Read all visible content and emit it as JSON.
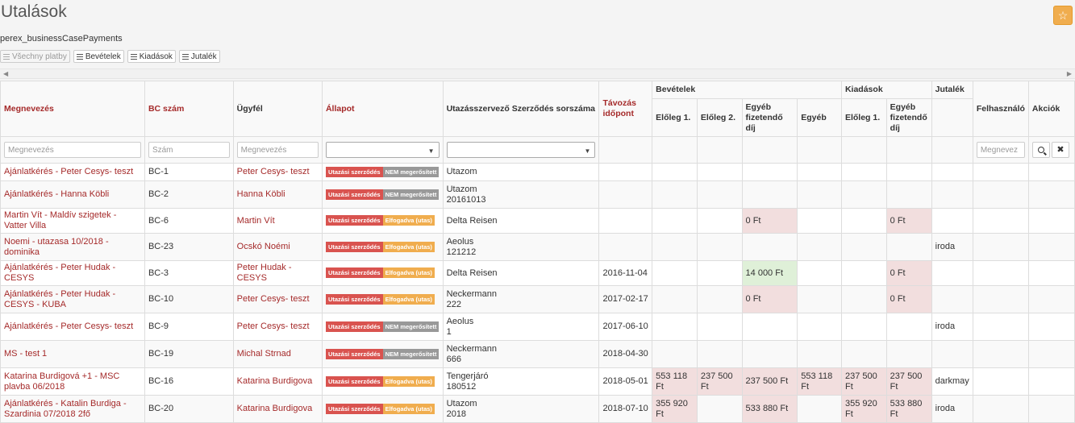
{
  "page": {
    "title": "Utalások",
    "subtitle": "perex_businessCasePayments"
  },
  "filters": [
    "Všechny platby",
    "Bevételek",
    "Kiadások",
    "Jutalék"
  ],
  "header": {
    "group_income": "Bevételek",
    "group_expense": "Kiadások",
    "group_commission": "Jutalék",
    "col_name": "Megnevezés",
    "col_bc": "BC szám",
    "col_client": "Ügyfél",
    "col_state": "Állapot",
    "col_contract": "Utazásszervező Szerződés sorszáma",
    "col_departure": "Távozás időpont",
    "col_user": "Felhasználó",
    "col_actions": "Akciók",
    "inc_adv1": "Előleg 1.",
    "inc_adv2": "Előleg 2.",
    "inc_other_fee": "Egyéb fizetendő díj",
    "inc_other": "Egyéb",
    "exp_adv1": "Előleg 1.",
    "exp_other_fee": "Egyéb fizetendő díj"
  },
  "filter_row": {
    "name_placeholder": "Megnevezés",
    "bc_placeholder": "Szám",
    "client_placeholder": "Megnevezés",
    "user_placeholder": "Megnevez"
  },
  "badges": {
    "contract": "Utazási szerződés",
    "not_confirmed": "NEM megerősített",
    "accepted": "Elfogadva (utas)"
  },
  "colors": {
    "accent": "#a52a2a",
    "star": "#f0ad4e",
    "negative_bg": "#f2dede",
    "positive_bg": "#dff0d8"
  },
  "rows": [
    {
      "name": "Ajánlatkérés - Peter Cesys- teszt",
      "bc": "BC-1",
      "client": "Peter Cesys- teszt",
      "status": "NEM megerősített",
      "contract1": "Utazom",
      "contract2": "",
      "departure": "",
      "inc1": "",
      "inc2": "",
      "incfee": "",
      "incother": "",
      "exp1": "",
      "expfee": "",
      "comm": ""
    },
    {
      "name": "Ajánlatkérés - Hanna Köbli",
      "bc": "BC-2",
      "client": "Hanna Köbli",
      "status": "NEM megerősített",
      "contract1": "Utazom",
      "contract2": "20161013",
      "departure": "",
      "inc1": "",
      "inc2": "",
      "incfee": "",
      "incother": "",
      "exp1": "",
      "expfee": "",
      "comm": ""
    },
    {
      "name": "Martin Vít - Maldív szigetek - Vatter Villa",
      "bc": "BC-6",
      "client": "Martin Vít",
      "status": "Elfogadva (utas)",
      "contract1": "Delta Reisen",
      "contract2": "",
      "departure": "",
      "inc1": "",
      "inc2": "",
      "incfee": "0 Ft",
      "incother": "",
      "exp1": "",
      "expfee": "0 Ft",
      "comm": ""
    },
    {
      "name": "Noemi - utazasa 10/2018 - dominika",
      "bc": "BC-23",
      "client": "Ocskó Noémi",
      "status": "Elfogadva (utas)",
      "contract1": "Aeolus",
      "contract2": "121212",
      "departure": "",
      "inc1": "",
      "inc2": "",
      "incfee": "",
      "incother": "",
      "exp1": "",
      "expfee": "",
      "comm": "iroda"
    },
    {
      "name": "Ajánlatkérés - Peter Hudak - CESYS",
      "bc": "BC-3",
      "client": "Peter Hudak - CESYS",
      "status": "Elfogadva (utas)",
      "contract1": "Delta Reisen",
      "contract2": "",
      "departure": "2016-11-04",
      "inc1": "",
      "inc2": "",
      "incfee": "14 000 Ft",
      "incother": "",
      "exp1": "",
      "expfee": "0 Ft",
      "comm": ""
    },
    {
      "name": "Ajánlatkérés - Peter Hudak - CESYS - KUBA",
      "bc": "BC-10",
      "client": "Peter Cesys- teszt",
      "status": "Elfogadva (utas)",
      "contract1": "Neckermann",
      "contract2": "222",
      "departure": "2017-02-17",
      "inc1": "",
      "inc2": "",
      "incfee": "0 Ft",
      "incother": "",
      "exp1": "",
      "expfee": "0 Ft",
      "comm": ""
    },
    {
      "name": "Ajánlatkérés - Peter Cesys- teszt",
      "bc": "BC-9",
      "client": "Peter Cesys- teszt",
      "status": "NEM megerősített",
      "contract1": "Aeolus",
      "contract2": "1",
      "departure": "2017-06-10",
      "inc1": "",
      "inc2": "",
      "incfee": "",
      "incother": "",
      "exp1": "",
      "expfee": "",
      "comm": "iroda"
    },
    {
      "name": "MS - test 1",
      "bc": "BC-19",
      "client": "Michal Strnad",
      "status": "NEM megerősített",
      "contract1": "Neckermann",
      "contract2": "666",
      "departure": "2018-04-30",
      "inc1": "",
      "inc2": "",
      "incfee": "",
      "incother": "",
      "exp1": "",
      "expfee": "",
      "comm": ""
    },
    {
      "name": "Katarina Burdigová +1 - MSC plavba 06/2018",
      "bc": "BC-16",
      "client": "Katarina Burdigova",
      "status": "Elfogadva (utas)",
      "contract1": "Tengerjáró",
      "contract2": "180512",
      "departure": "2018-05-01",
      "inc1": "553 118 Ft",
      "inc2": "237 500 Ft",
      "incfee": "237 500 Ft",
      "incother": "553 118 Ft",
      "exp1": "237 500 Ft",
      "expfee": "237 500 Ft",
      "comm": "darkmay"
    },
    {
      "name": "Ajánlatkérés - Katalin Burdiga - Szardinia 07/2018 2fő",
      "bc": "BC-20",
      "client": "Katarina Burdigova",
      "status": "Elfogadva (utas)",
      "contract1": "Utazom",
      "contract2": "2018",
      "departure": "2018-07-10",
      "inc1": "355 920 Ft",
      "inc2": "",
      "incfee": "533 880 Ft",
      "incother": "",
      "exp1": "355 920 Ft",
      "expfee": "533 880 Ft",
      "comm": "iroda"
    }
  ]
}
